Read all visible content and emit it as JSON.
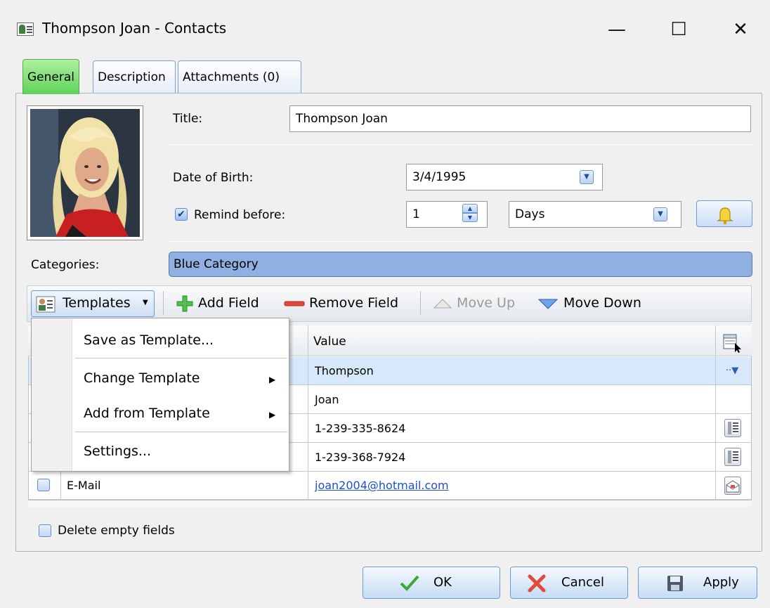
{
  "window": {
    "title": "Thompson Joan - Contacts",
    "minimize": "—",
    "maximize": "☐",
    "close": "✕"
  },
  "tabs": [
    {
      "label": "General",
      "active": true
    },
    {
      "label": "Description",
      "active": false
    },
    {
      "label": "Attachments (0)",
      "active": false
    }
  ],
  "form": {
    "title_label": "Title:",
    "title_value": "Thompson Joan",
    "dob_label": "Date of Birth:",
    "dob_value": "3/4/1995",
    "remind_label": "Remind before:",
    "remind_checked": true,
    "remind_value": "1",
    "remind_unit": "Days",
    "categories_label": "Categories:",
    "categories_value": "Blue Category"
  },
  "toolbar": {
    "templates": "Templates",
    "add_field": "Add Field",
    "remove_field": "Remove Field",
    "move_up": "Move Up",
    "move_down": "Move Down"
  },
  "menu": {
    "save_as_template": "Save as Template...",
    "change_template": "Change Template",
    "add_from_template": "Add from Template",
    "settings": "Settings..."
  },
  "grid": {
    "value_header": "Value",
    "rows": [
      {
        "name": "",
        "value": "Thompson",
        "icon": "dropdown-dots"
      },
      {
        "name": "",
        "value": "Joan",
        "icon": ""
      },
      {
        "name": "",
        "value": "1-239-335-8624",
        "icon": "phone-icon"
      },
      {
        "name": "",
        "value": "1-239-368-7924",
        "icon": "phone-icon"
      },
      {
        "name": "E-Mail",
        "value": "joan2004@hotmail.com",
        "icon": "mail-icon"
      }
    ]
  },
  "delete_empty_label": "Delete empty fields",
  "buttons": {
    "ok": "OK",
    "cancel": "Cancel",
    "apply": "Apply"
  },
  "colors": {
    "active_tab": "#5fd25a",
    "category": "#8fb0e0",
    "selected_row": "#d8e8fb",
    "link": "#1f4fd0"
  }
}
